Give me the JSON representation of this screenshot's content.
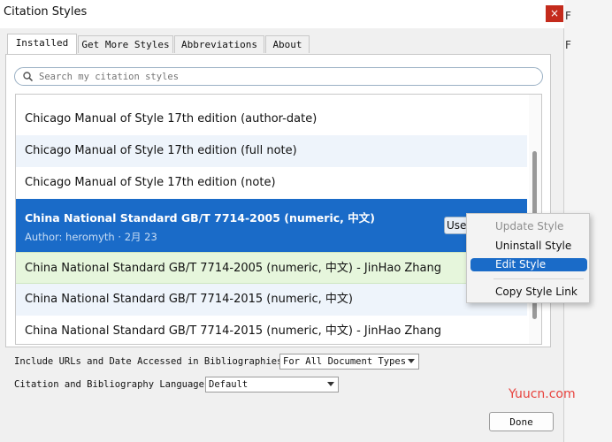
{
  "window": {
    "title": "Citation Styles",
    "close_label": "×"
  },
  "background": {
    "edge_glyphs": [
      "F",
      "F"
    ]
  },
  "tabs": [
    {
      "label": "Installed",
      "active": true
    },
    {
      "label": "Get More Styles",
      "active": false
    },
    {
      "label": "Abbreviations",
      "active": false
    },
    {
      "label": "About",
      "active": false
    }
  ],
  "search": {
    "placeholder": "Search my citation styles",
    "value": ""
  },
  "styles": {
    "rows": [
      {
        "title": "Chicago Manual of Style 17th edition (author-date)"
      },
      {
        "title": "Chicago Manual of Style 17th edition (full note)"
      },
      {
        "title": "Chicago Manual of Style 17th edition (note)"
      },
      {
        "title": "China National Standard GB/T 7714-2005 (numeric, 中文)",
        "subtitle": "Author: heromyth · 2月 23",
        "selected": true,
        "button": "Use"
      },
      {
        "title": "China National Standard GB/T 7714-2005 (numeric, 中文) - JinHao Zhang"
      },
      {
        "title": "China National Standard GB/T 7714-2015 (numeric, 中文)"
      },
      {
        "title": "China National Standard GB/T 7714-2015 (numeric, 中文) - JinHao Zhang"
      }
    ]
  },
  "context_menu": {
    "items": [
      {
        "label": "Update Style",
        "disabled": true
      },
      {
        "label": "Uninstall Style"
      },
      {
        "label": "Edit Style",
        "highlighted": true
      },
      {
        "label": "Copy Style Link"
      }
    ]
  },
  "options": {
    "include_urls_label": "Include URLs and Date Accessed in Bibliographies:",
    "include_urls_value": "For All Document Types",
    "language_label": "Citation and Bibliography Language:",
    "language_value": "Default"
  },
  "footer": {
    "done_label": "Done"
  },
  "watermark": "Yuucn.com",
  "colors": {
    "selection": "#1a6bc8",
    "close": "#c42b1c",
    "highlight_green": "#e6f6dc",
    "alt_row": "#eef4fb"
  }
}
